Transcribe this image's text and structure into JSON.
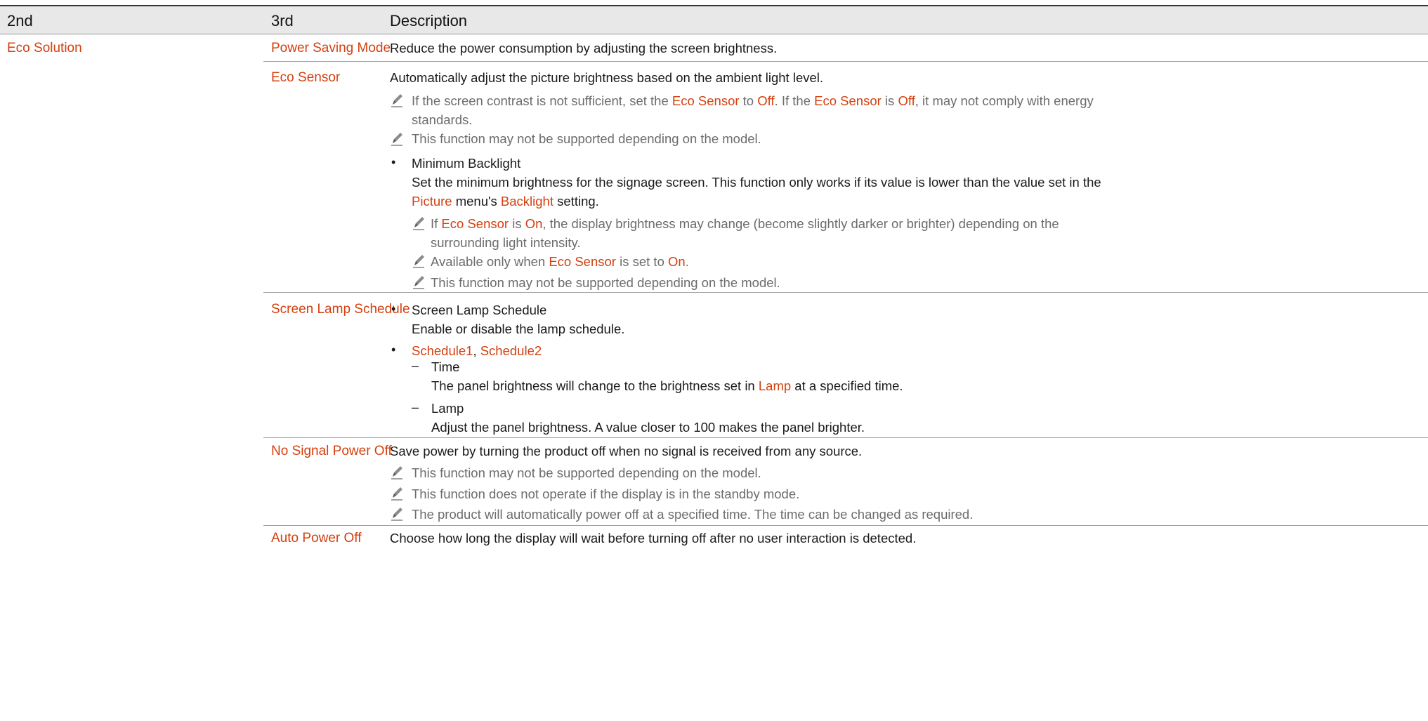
{
  "headers": {
    "col2": "2nd",
    "col3": "3rd",
    "desc": "Description"
  },
  "section": {
    "label": "Eco Solution"
  },
  "rows": {
    "power_saving": {
      "label": "Power Saving Mode",
      "desc": "Reduce the power consumption by adjusting the screen brightness."
    },
    "eco_sensor": {
      "label": "Eco Sensor",
      "desc": "Automatically adjust the picture brightness based on the ambient light level.",
      "note1": {
        "t1": "If the screen contrast is not sufficient, set the ",
        "h1": "Eco Sensor",
        "t2": " to ",
        "h2": "Off",
        "t3": ". If the ",
        "h3": "Eco Sensor",
        "t4": " is ",
        "h4": "Off",
        "t5": ", it may not comply with energy",
        "line2": "standards."
      },
      "note2": "This function may not be supported depending on the model.",
      "min_backlight": {
        "title": "Minimum Backlight",
        "line1": "Set the minimum brightness for the signage screen. This function only works if its value is lower than the value set in the",
        "h_picture": "Picture",
        "t_menu": " menu's ",
        "h_backlight": "Backlight",
        "t_setting": " setting."
      },
      "sub_note1": {
        "t1": "If ",
        "h1": "Eco Sensor",
        "t2": " is ",
        "h2": "On",
        "t3": ", the display brightness may change (become slightly darker or brighter) depending on the",
        "line2": "surrounding light intensity."
      },
      "sub_note2": {
        "t1": "Available only when ",
        "h1": "Eco Sensor",
        "t2": " is set to ",
        "h2": "On",
        "t3": "."
      },
      "sub_note3": "This function may not be supported depending on the model."
    },
    "screen_lamp": {
      "label": "Screen Lamp Schedule",
      "b1_title": "Screen Lamp Schedule",
      "b1_desc": "Enable or disable the lamp schedule.",
      "b2_h1": "Schedule1",
      "b2_sep": ", ",
      "b2_h2": "Schedule2",
      "time_title": "Time",
      "time_t1": "The panel brightness will change to the brightness set in ",
      "time_h1": "Lamp",
      "time_t2": " at a specified time.",
      "lamp_title": "Lamp",
      "lamp_desc": "Adjust the panel brightness. A value closer to 100 makes the panel brighter."
    },
    "no_signal": {
      "label": "No Signal Power Off",
      "desc": "Save power by turning the product off when no signal is received from any source.",
      "note1": "This function may not be supported depending on the model.",
      "note2": "This function does not operate if the display is in the standby mode.",
      "note3": "The product will automatically power off at a specified time. The time can be changed as required."
    },
    "auto_power": {
      "label": "Auto Power Off",
      "desc": "Choose how long the display will wait before turning off after no user interaction is detected."
    }
  },
  "markers": {
    "bullet": "•",
    "dash": "–"
  },
  "colors": {
    "highlight": "#d4400f",
    "note_text": "#6c6c6c",
    "header_bg": "#e8e8e8"
  },
  "icons": {
    "note": "pencil-icon"
  }
}
